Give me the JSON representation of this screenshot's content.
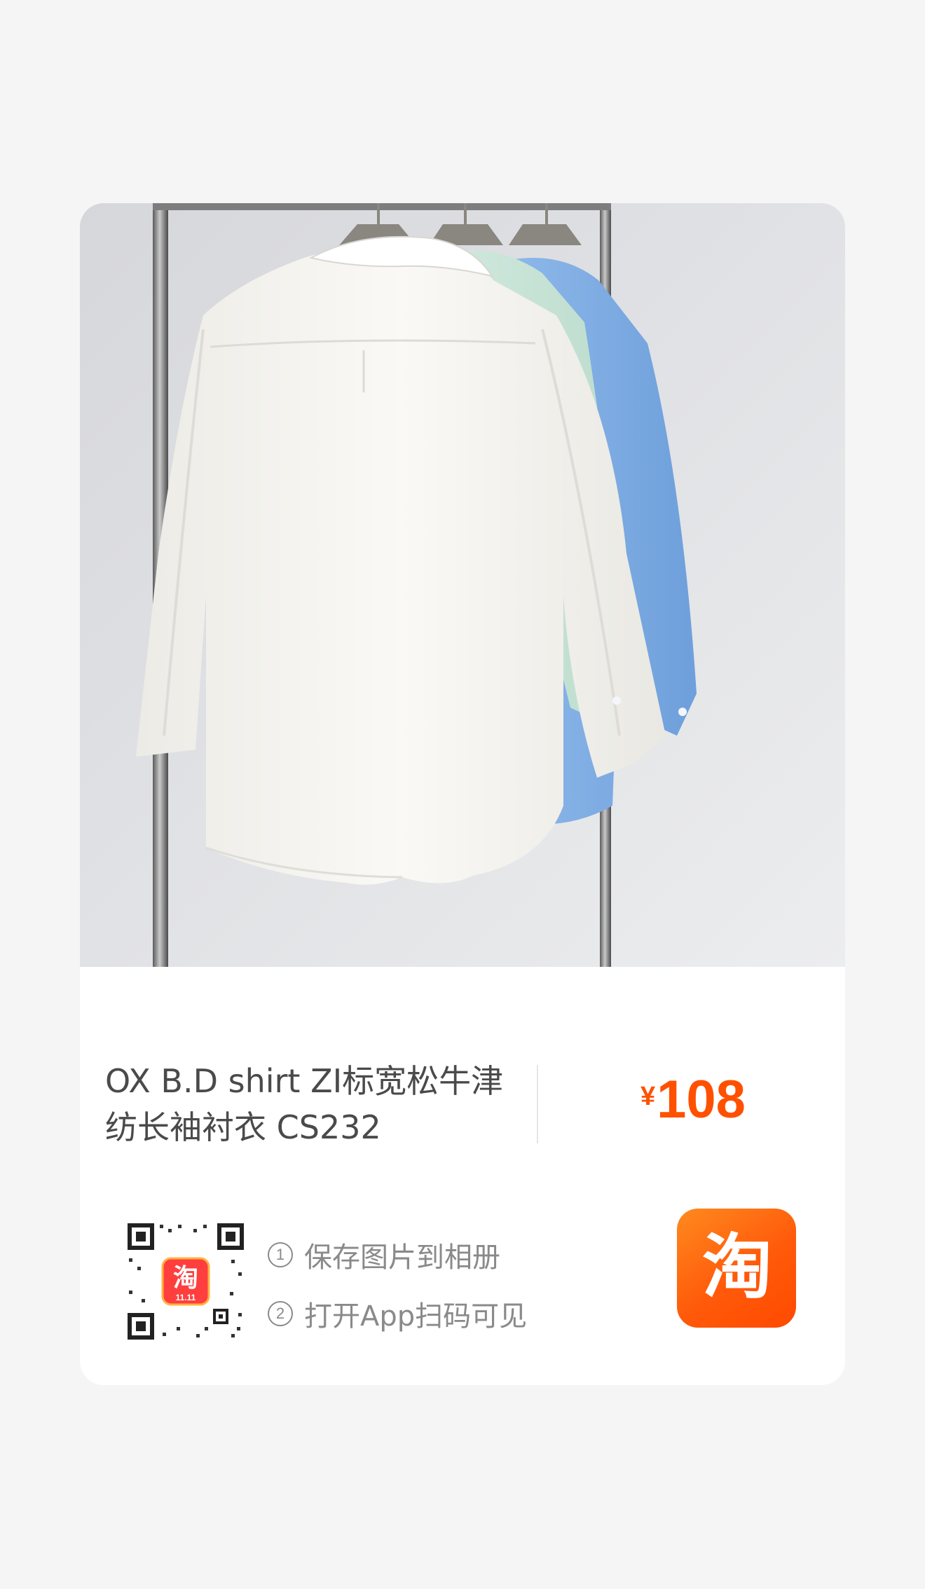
{
  "product": {
    "title_line1": "OX B.D shirt ZI标宽松牛津",
    "title_line2": "纺长袖衬衣 CS232",
    "currency": "¥",
    "price": "108"
  },
  "share": {
    "step1_num": "1",
    "step1_text": "保存图片到相册",
    "step2_num": "2",
    "step2_text": "打开App扫码可见"
  },
  "app": {
    "icon": "taobao-app-icon",
    "logo_char": "淘",
    "qr_badge_char": "淘",
    "qr_badge_text": "11.11"
  },
  "colors": {
    "accent": "#ff5000",
    "text": "#4a4a4a",
    "muted": "#8a8a8a"
  }
}
